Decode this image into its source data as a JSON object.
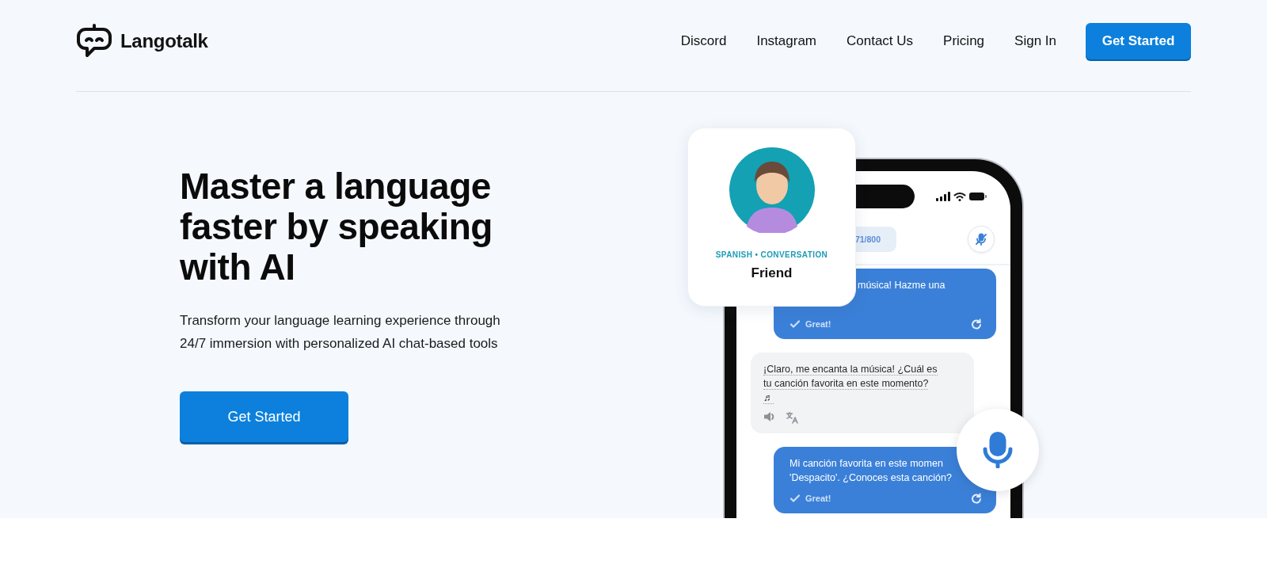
{
  "header": {
    "logo": "Langotalk",
    "nav": [
      {
        "label": "Discord"
      },
      {
        "label": "Instagram"
      },
      {
        "label": "Contact Us"
      },
      {
        "label": "Pricing"
      },
      {
        "label": "Sign In"
      }
    ],
    "cta": "Get Started"
  },
  "hero": {
    "title_lines": [
      "Master a language",
      "faster by speaking",
      "with AI"
    ],
    "subtitle_lines": [
      "Transform your language learning experience through",
      "24/7 immersion with personalized AI chat-based tools"
    ],
    "cta": "Get Started"
  },
  "mockup": {
    "card": {
      "label": "SPANISH • CONVERSATION",
      "name": "Friend"
    },
    "progress": "71/800",
    "messages": [
      {
        "kind": "user",
        "lines": [
          "música! Hazme una"
        ],
        "feedback": "Great!"
      },
      {
        "kind": "ai",
        "lines": [
          "¡Claro, me encanta la música! ¿Cuál es",
          "tu canción favorita en este momento?",
          "♬"
        ]
      },
      {
        "kind": "user",
        "lines": [
          "Mi canción favorita en este momen",
          "'Despacito'. ¿Conoces esta canción?"
        ],
        "feedback": "Great!"
      }
    ]
  }
}
